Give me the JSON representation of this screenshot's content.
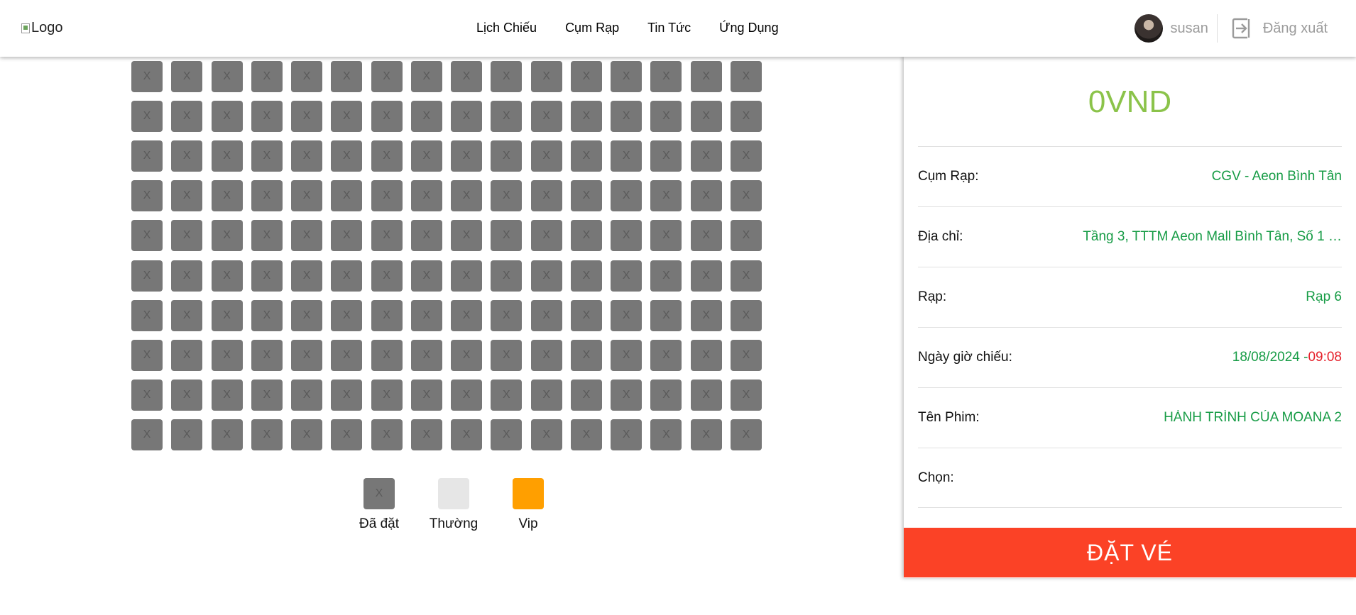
{
  "header": {
    "logo_alt": "Logo",
    "nav": [
      "Lịch Chiếu",
      "Cụm Rạp",
      "Tin Tức",
      "Ứng Dụng"
    ],
    "username": "susan",
    "logout_label": "Đăng xuất"
  },
  "seat_map": {
    "rows": 10,
    "cols": 16,
    "seat_label": "X",
    "status": "booked"
  },
  "legend": [
    {
      "label": "Đã đặt",
      "mark": "X",
      "color": "#777777"
    },
    {
      "label": "Thường",
      "mark": "",
      "color": "#e6e6e6"
    },
    {
      "label": "Vip",
      "mark": "",
      "color": "#ff9f00"
    }
  ],
  "booking": {
    "total": "0VND",
    "rows": [
      {
        "label": "Cụm Rạp:",
        "value": "CGV - Aeon Bình Tân"
      },
      {
        "label": "Địa chỉ:",
        "value": "Tầng 3, TTTM Aeon Mall Bình Tân, Số 1 …"
      },
      {
        "label": "Rạp:",
        "value": "Rạp 6"
      },
      {
        "label": "Ngày giờ chiếu:",
        "value": "18/08/2024 -",
        "time": "09:08"
      },
      {
        "label": "Tên Phim:",
        "value": "HÀNH TRÌNH CỦA MOANA 2"
      },
      {
        "label": "Chọn:",
        "value": ""
      }
    ],
    "button_label": "ĐẶT VÉ"
  },
  "colors": {
    "total": "#8bc34a",
    "value": "#179c46",
    "time": "#e5212b",
    "button": "#fb4226",
    "seat_booked": "#777777"
  }
}
